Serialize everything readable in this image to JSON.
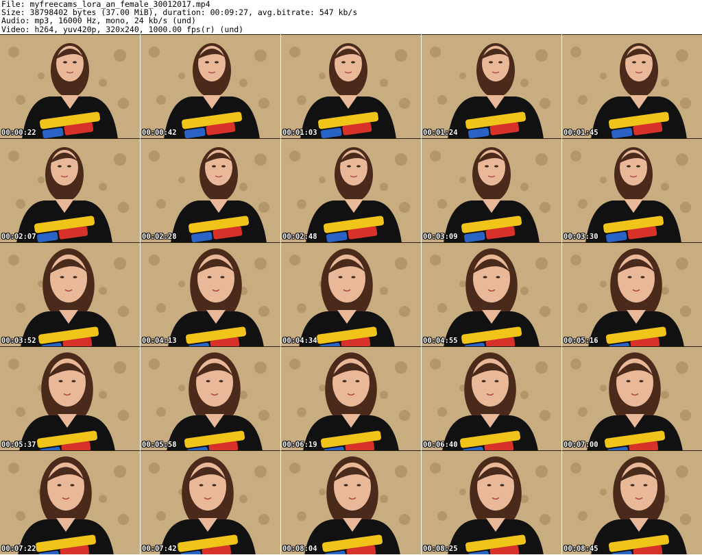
{
  "header": {
    "file": "File: myfreecams_lora_an_female_30012017.mp4",
    "size": "Size: 38798402 bytes (37.00 MiB), duration: 00:09:27, avg.bitrate: 547 kb/s",
    "audio": "Audio: mp3, 16000 Hz, mono, 24 kb/s (und)",
    "video": "Video: h264, yuv420p, 320x240, 1000.00 fps(r) (und)"
  },
  "thumbnails": [
    {
      "time": "00:00:22"
    },
    {
      "time": "00:00:42"
    },
    {
      "time": "00:01:03"
    },
    {
      "time": "00:01:24"
    },
    {
      "time": "00:01:45"
    },
    {
      "time": "00:02:07"
    },
    {
      "time": "00:02:28"
    },
    {
      "time": "00:02:48"
    },
    {
      "time": "00:03:09"
    },
    {
      "time": "00:03:30"
    },
    {
      "time": "00:03:52"
    },
    {
      "time": "00:04:13"
    },
    {
      "time": "00:04:34"
    },
    {
      "time": "00:04:55"
    },
    {
      "time": "00:05:16"
    },
    {
      "time": "00:05:37"
    },
    {
      "time": "00:05:58"
    },
    {
      "time": "00:06:19"
    },
    {
      "time": "00:06:40"
    },
    {
      "time": "00:07:00"
    },
    {
      "time": "00:07:22"
    },
    {
      "time": "00:07:42"
    },
    {
      "time": "00:08:04"
    },
    {
      "time": "00:08:25"
    },
    {
      "time": "00:08:45"
    }
  ],
  "colors": {
    "wallpaper": "#c8ad80",
    "shirt": "#111111",
    "hair": "#4a2a1a",
    "skin": "#e9b899",
    "timestamp_text": "#ffffff"
  }
}
